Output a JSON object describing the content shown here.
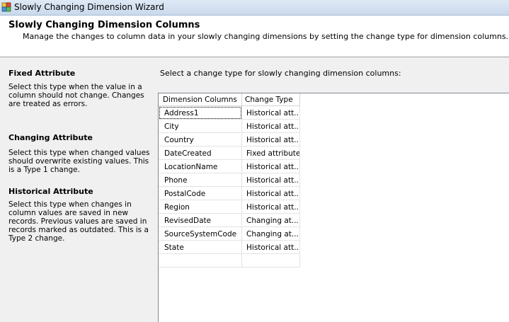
{
  "window": {
    "title": "Slowly Changing Dimension Wizard"
  },
  "header": {
    "title": "Slowly Changing Dimension Columns",
    "subtitle": "Manage the changes to column data in your slowly changing dimensions by setting the change type for dimension columns."
  },
  "descriptions": [
    {
      "heading": "Fixed Attribute",
      "text": "Select this type when the value in a column should not change. Changes are treated as errors."
    },
    {
      "heading": "Changing Attribute",
      "text": "Select this type when changed values should overwrite existing values. This is a Type 1 change."
    },
    {
      "heading": "Historical Attribute",
      "text": "Select this type when changes in column values are saved in new records. Previous values are saved in records marked as outdated. This is a Type 2 change."
    }
  ],
  "instruction": "Select a change type for slowly changing dimension columns:",
  "grid": {
    "columns": [
      "Dimension Columns",
      "Change Type"
    ],
    "rows": [
      {
        "column": "Address1",
        "type": "Historical att..."
      },
      {
        "column": "City",
        "type": "Historical att..."
      },
      {
        "column": "Country",
        "type": "Historical att..."
      },
      {
        "column": "DateCreated",
        "type": "Fixed attribute"
      },
      {
        "column": "LocationName",
        "type": "Historical att..."
      },
      {
        "column": "Phone",
        "type": "Historical att..."
      },
      {
        "column": "PostalCode",
        "type": "Historical att..."
      },
      {
        "column": "Region",
        "type": "Historical att..."
      },
      {
        "column": "RevisedDate",
        "type": "Changing at..."
      },
      {
        "column": "SourceSystemCode",
        "type": "Changing at..."
      },
      {
        "column": "State",
        "type": "Historical att..."
      },
      {
        "column": "",
        "type": ""
      }
    ]
  }
}
